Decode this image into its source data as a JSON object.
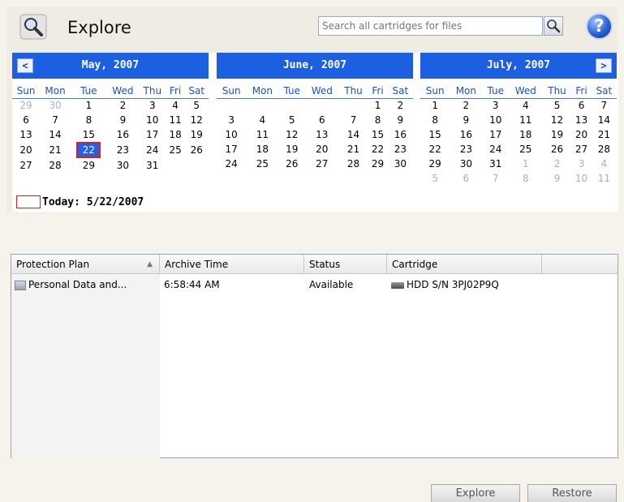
{
  "header": {
    "title": "Explore",
    "search_placeholder": "Search all cartridges for files",
    "help_symbol": "?"
  },
  "calendar": {
    "weekdays": [
      "Sun",
      "Mon",
      "Tue",
      "Wed",
      "Thu",
      "Fri",
      "Sat"
    ],
    "months": [
      {
        "title": "May, 2007",
        "weeks": [
          [
            "29",
            "30",
            "1",
            "2",
            "3",
            "4",
            "5"
          ],
          [
            "6",
            "7",
            "8",
            "9",
            "10",
            "11",
            "12"
          ],
          [
            "13",
            "14",
            "15",
            "16",
            "17",
            "18",
            "19"
          ],
          [
            "20",
            "21",
            "22",
            "23",
            "24",
            "25",
            "26"
          ],
          [
            "27",
            "28",
            "29",
            "30",
            "31",
            "",
            ""
          ]
        ],
        "other_month_cells": [
          [
            0,
            0
          ],
          [
            0,
            1
          ]
        ],
        "selected": [
          3,
          2
        ]
      },
      {
        "title": "June, 2007",
        "weeks": [
          [
            "",
            "",
            "",
            "",
            "",
            "1",
            "2"
          ],
          [
            "3",
            "4",
            "5",
            "6",
            "7",
            "8",
            "9"
          ],
          [
            "10",
            "11",
            "12",
            "13",
            "14",
            "15",
            "16"
          ],
          [
            "17",
            "18",
            "19",
            "20",
            "21",
            "22",
            "23"
          ],
          [
            "24",
            "25",
            "26",
            "27",
            "28",
            "29",
            "30"
          ]
        ],
        "other_month_cells": [],
        "selected": null
      },
      {
        "title": "July, 2007",
        "weeks": [
          [
            "1",
            "2",
            "3",
            "4",
            "5",
            "6",
            "7"
          ],
          [
            "8",
            "9",
            "10",
            "11",
            "12",
            "13",
            "14"
          ],
          [
            "15",
            "16",
            "17",
            "18",
            "19",
            "20",
            "21"
          ],
          [
            "22",
            "23",
            "24",
            "25",
            "26",
            "27",
            "28"
          ],
          [
            "29",
            "30",
            "31",
            "1",
            "2",
            "3",
            "4"
          ],
          [
            "5",
            "6",
            "7",
            "8",
            "9",
            "10",
            "11"
          ]
        ],
        "other_month_cells": [
          [
            4,
            3
          ],
          [
            4,
            4
          ],
          [
            4,
            5
          ],
          [
            4,
            6
          ],
          [
            5,
            0
          ],
          [
            5,
            1
          ],
          [
            5,
            2
          ],
          [
            5,
            3
          ],
          [
            5,
            4
          ],
          [
            5,
            5
          ],
          [
            5,
            6
          ]
        ],
        "selected": null
      }
    ],
    "today_label": "Today: 5/22/2007",
    "prev_symbol": "<",
    "next_symbol": ">"
  },
  "grid": {
    "columns": [
      "Protection Plan",
      "Archive Time",
      "Status",
      "Cartridge"
    ],
    "sort_symbol": "▲",
    "rows": [
      {
        "plan": "Personal Data and...",
        "time": "6:58:44 AM",
        "status": "Available",
        "cartridge": "HDD S/N 3PJ02P9Q"
      }
    ]
  },
  "buttons": {
    "explore": "Explore",
    "restore": "Restore"
  },
  "colors": {
    "accent": "#1c5fe0",
    "selected_border": "#e02020"
  }
}
